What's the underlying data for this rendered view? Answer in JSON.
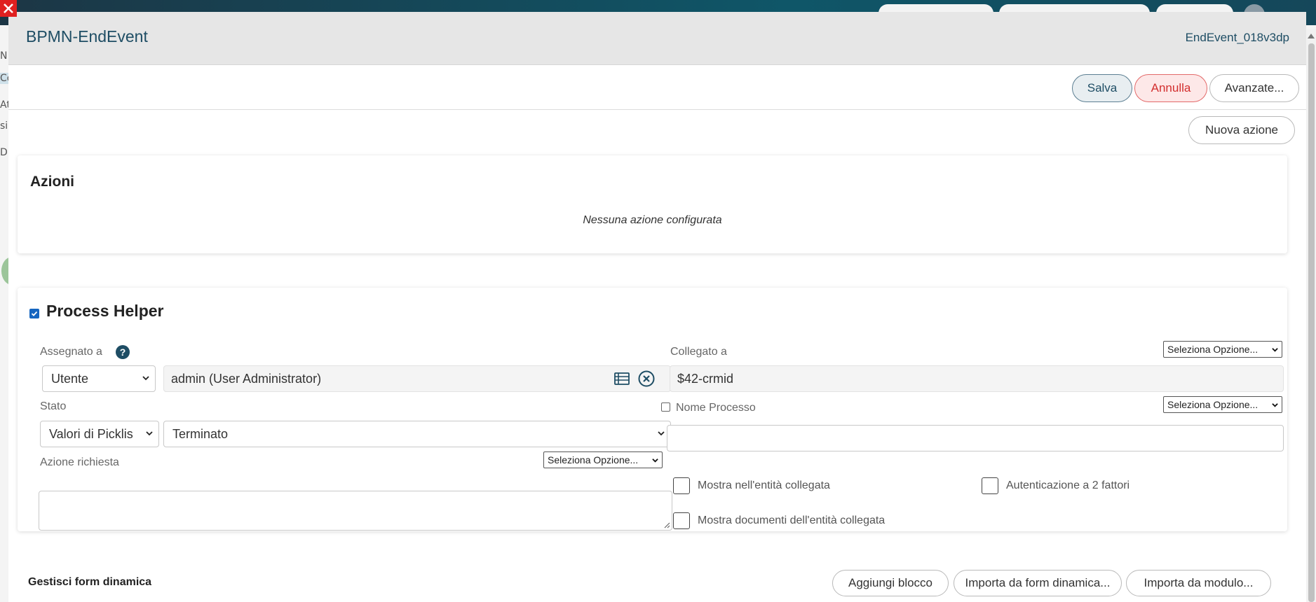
{
  "modal": {
    "title": "BPMN-EndEvent",
    "element_id": "EndEvent_018v3dp"
  },
  "toolbar": {
    "save_label": "Salva",
    "cancel_label": "Annulla",
    "advanced_label": "Avanzate..."
  },
  "new_action_label": "Nuova azione",
  "actions_section": {
    "title": "Azioni",
    "empty_message": "Nessuna azione configurata"
  },
  "process_helper": {
    "title": "Process Helper",
    "enabled": true,
    "assigned_to": {
      "label": "Assegnato a",
      "help_glyph": "?",
      "type_value": "Utente",
      "user_value": "admin (User Administrator)"
    },
    "linked_to": {
      "label": "Collegato a",
      "option_select": "Seleziona Opzione...",
      "value": "$42-crmid"
    },
    "status": {
      "label": "Stato",
      "source_value": "Valori di Picklis",
      "value": "Terminato"
    },
    "process_name": {
      "label": "Nome Processo",
      "option_select": "Seleziona Opzione...",
      "value": ""
    },
    "required_action": {
      "label": "Azione richiesta",
      "option_select": "Seleziona Opzione..."
    },
    "options": {
      "show_in_linked_entity": "Mostra nell'entità collegata",
      "two_factor_auth": "Autenticazione a 2 fattori",
      "show_linked_entity_docs": "Mostra documenti dell'entità collegata"
    }
  },
  "dynamic_form": {
    "title": "Gestisci form dinamica",
    "add_block_label": "Aggiungi blocco",
    "import_form_label": "Importa da form dinamica...",
    "import_module_label": "Importa da modulo..."
  },
  "background": {
    "side_letters": [
      "N",
      "Co",
      "At",
      "si",
      "Di"
    ]
  },
  "colors": {
    "accent": "#1e4d64",
    "cancel": "#d32f2f",
    "checkbox": "#1565c0"
  }
}
